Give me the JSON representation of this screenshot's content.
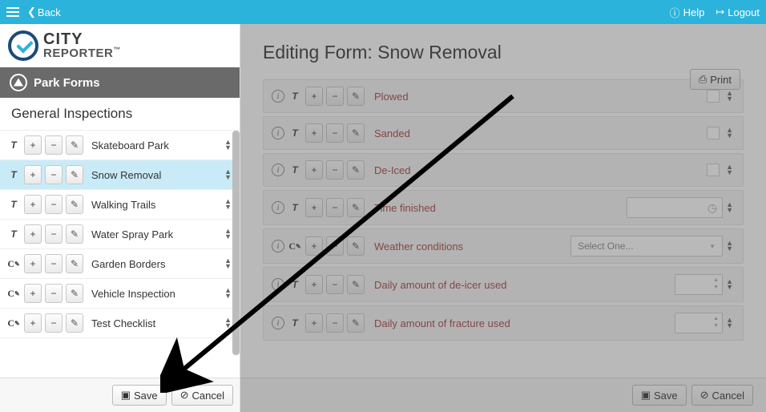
{
  "topbar": {
    "back": "Back",
    "help": "Help",
    "logout": "Logout"
  },
  "brand": {
    "line1": "CITY",
    "line2": "REPORTER",
    "tm": "™"
  },
  "sidebar": {
    "section_title": "Park Forms",
    "subsection_title": "General Inspections",
    "forms": [
      {
        "type": "T",
        "name": "Skateboard Park"
      },
      {
        "type": "T",
        "name": "Snow Removal",
        "selected": true
      },
      {
        "type": "T",
        "name": "Walking Trails"
      },
      {
        "type": "T",
        "name": "Water Spray Park"
      },
      {
        "type": "C",
        "name": "Garden Borders"
      },
      {
        "type": "C",
        "name": "Vehicle Inspection"
      },
      {
        "type": "C",
        "name": "Test Checklist"
      }
    ],
    "save": "Save",
    "cancel": "Cancel"
  },
  "main": {
    "title": "Editing Form: Snow Removal",
    "print": "Print",
    "save": "Save",
    "cancel": "Cancel",
    "questions": [
      {
        "type": "T",
        "label": "Plowed",
        "control": "checkbox"
      },
      {
        "type": "T",
        "label": "Sanded",
        "control": "checkbox"
      },
      {
        "type": "T",
        "label": "De-Iced",
        "control": "checkbox"
      },
      {
        "type": "T",
        "label": "Time finished",
        "control": "time"
      },
      {
        "type": "C",
        "label": "Weather conditions",
        "control": "select",
        "placeholder": "Select One..."
      },
      {
        "type": "T",
        "label": "Daily amount of de-icer used",
        "control": "stepper"
      },
      {
        "type": "T",
        "label": "Daily amount of fracture used",
        "control": "stepper"
      }
    ]
  }
}
